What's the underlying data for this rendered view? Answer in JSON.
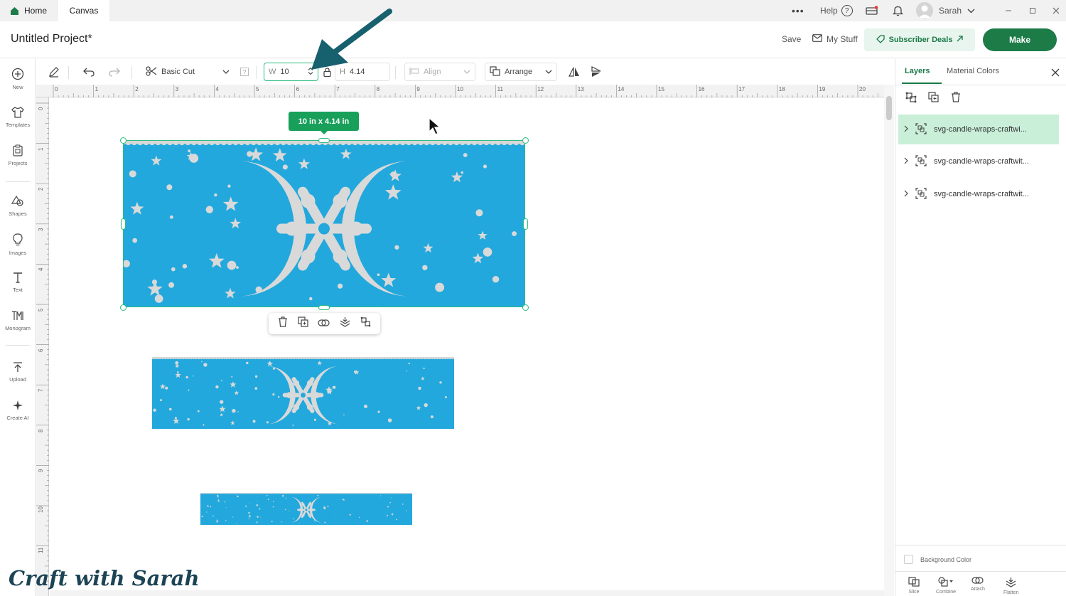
{
  "tabs": [
    {
      "label": "Home",
      "icon": "home-icon"
    },
    {
      "label": "Canvas"
    }
  ],
  "topbar": {
    "more": "•••",
    "help_label": "Help",
    "user_name": "Sarah"
  },
  "header": {
    "project_title": "Untitled Project*",
    "save_label": "Save",
    "my_stuff_label": "My Stuff",
    "subscriber_deals_label": "Subscriber Deals",
    "make_label": "Make"
  },
  "sidebar": {
    "items": [
      {
        "label": "New",
        "icon": "plus-circle-icon"
      },
      {
        "label": "Templates",
        "icon": "shirt-icon"
      },
      {
        "label": "Projects",
        "icon": "clipboard-icon"
      },
      {
        "label": "Shapes",
        "icon": "shapes-icon"
      },
      {
        "label": "Images",
        "icon": "lightbulb-icon"
      },
      {
        "label": "Text",
        "icon": "text-icon"
      },
      {
        "label": "Monogram",
        "icon": "monogram-icon"
      },
      {
        "label": "Upload",
        "icon": "upload-icon"
      },
      {
        "label": "Create AI",
        "icon": "sparkle-icon"
      }
    ]
  },
  "toolbar": {
    "operation": "Basic Cut",
    "width_label": "W",
    "width_value": "10",
    "height_label": "H",
    "height_value": "4.14",
    "align_label": "Align",
    "arrange_label": "Arrange"
  },
  "rulers": {
    "top": [
      "0",
      "1",
      "2",
      "3",
      "4",
      "5",
      "6",
      "7",
      "8",
      "9",
      "10",
      "11",
      "12",
      "13",
      "14",
      "15",
      "16",
      "17",
      "18",
      "19",
      "20"
    ],
    "left": [
      "0",
      "1",
      "2",
      "3",
      "4",
      "5",
      "6",
      "7",
      "8",
      "9",
      "10",
      "11"
    ]
  },
  "canvas": {
    "size_badge": "10 in x 4.14 in"
  },
  "right_panel": {
    "tabs": [
      "Layers",
      "Material Colors"
    ],
    "layers": [
      {
        "name": "svg-candle-wraps-craftwi...",
        "selected": true
      },
      {
        "name": "svg-candle-wraps-craftwit...",
        "selected": false
      },
      {
        "name": "svg-candle-wraps-craftwit...",
        "selected": false
      }
    ],
    "background_color_label": "Background Color",
    "bottom_actions": [
      "Slice",
      "Combine",
      "Attach",
      "Flatten"
    ]
  },
  "watermark": "Craft with Sarah",
  "colors": {
    "accent": "#1d7b48",
    "selection": "#2bbd7e",
    "wrap_fill": "#22a8dc",
    "cutout": "#d9d9d9"
  }
}
